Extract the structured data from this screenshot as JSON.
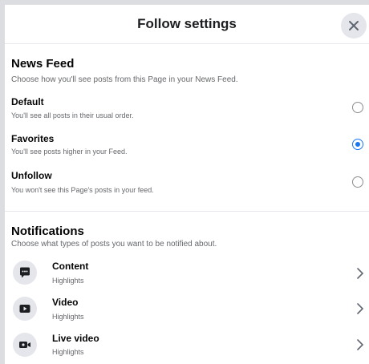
{
  "dialog": {
    "title": "Follow settings",
    "close_icon": "close-icon"
  },
  "news_feed": {
    "title": "News Feed",
    "description": "Choose how you'll see posts from this Page in your News Feed.",
    "options": [
      {
        "label": "Default",
        "description": "You'll see all posts in their usual order.",
        "selected": false
      },
      {
        "label": "Favorites",
        "description": "You'll see posts higher in your Feed.",
        "selected": true
      },
      {
        "label": "Unfollow",
        "description": "You won't see this Page's posts in your feed.",
        "selected": false
      }
    ]
  },
  "notifications": {
    "title": "Notifications",
    "description": "Choose what types of posts you want to be notified about.",
    "items": [
      {
        "label": "Content",
        "sub": "Highlights",
        "icon": "chat-bubble-icon"
      },
      {
        "label": "Video",
        "sub": "Highlights",
        "icon": "video-play-icon"
      },
      {
        "label": "Live video",
        "sub": "Highlights",
        "icon": "live-video-icon"
      }
    ]
  },
  "colors": {
    "accent": "#1877f2",
    "secondary_text": "#65676b",
    "icon_background": "#e4e6eb"
  }
}
